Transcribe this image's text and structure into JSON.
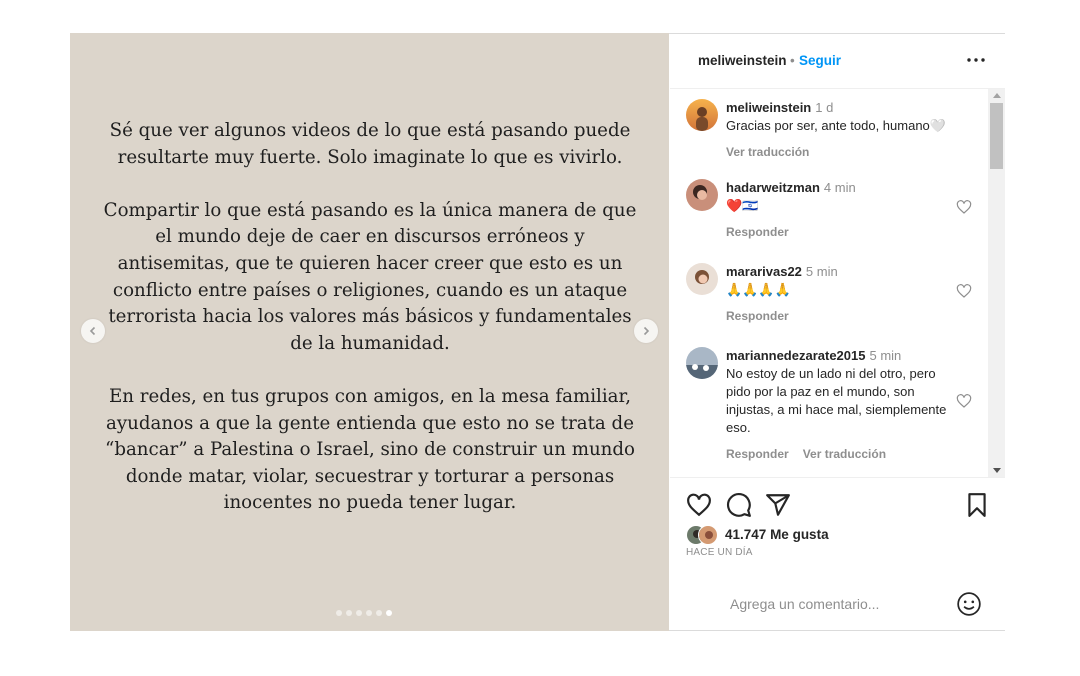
{
  "media": {
    "paragraphs": [
      "Sé que ver algunos videos de lo que está pasando puede resultarte muy fuerte. Solo imaginate lo que es vivirlo.",
      "Compartir lo que está pasando es la única manera de que el mundo deje de caer en discursos erróneos y antisemitas, que te quieren hacer creer que esto es un conflicto entre países o religiones, cuando es un ataque terrorista hacia los valores más básicos y fundamentales de la humanidad.",
      "En redes, en tus grupos con amigos, en la mesa familiar, ayudanos a que la gente entienda que esto no se trata de “bancar” a Palestina o Israel, sino de construir un mundo donde matar, violar, secuestrar y torturar a personas inocentes no pueda tener lugar."
    ],
    "carousel": {
      "total": 6,
      "active_index": 5
    },
    "background_color": "#dcd5cb"
  },
  "header": {
    "username": "meliweinstein",
    "separator": "•",
    "follow_label": "Seguir",
    "more_icon": "more-horizontal-icon"
  },
  "comments": [
    {
      "username": "meliweinstein",
      "time": "1 d",
      "text": "Gracias por ser, ante todo, humano🤍",
      "meta": [
        "Ver traducción"
      ],
      "like": false
    },
    {
      "username": "hadarweitzman",
      "time": "4 min",
      "text": "❤️🇮🇱",
      "meta": [
        "Responder"
      ],
      "like": true
    },
    {
      "username": "mararivas22",
      "time": "5 min",
      "text": "🙏🙏🙏🙏",
      "meta": [
        "Responder"
      ],
      "like": true
    },
    {
      "username": "mariannedezarate2015",
      "time": "5 min",
      "text": "No estoy de un lado ni del otro, pero pido por la paz en el mundo, son injustas, a mi hace mal, siemplemente eso.",
      "meta": [
        "Responder",
        "Ver traducción"
      ],
      "like": true
    }
  ],
  "actions": {
    "icons": [
      "heart-icon",
      "comment-icon",
      "share-icon",
      "bookmark-icon"
    ],
    "likes_count": "41.747",
    "likes_label": "Me gusta",
    "posted_time": "HACE UN DÍA"
  },
  "add_comment": {
    "placeholder": "Agrega un comentario...",
    "emoji_icon": "emoji-icon"
  },
  "colors": {
    "link": "#0095f6",
    "muted": "#8e8e8e",
    "text": "#262626",
    "border": "#dbdbdb"
  }
}
